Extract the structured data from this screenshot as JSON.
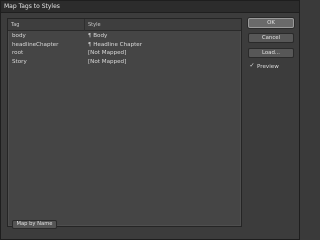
{
  "window": {
    "title": "Map Tags to Styles"
  },
  "table": {
    "headers": {
      "tag": "Tag",
      "style": "Style"
    },
    "rows": [
      {
        "tag": "body",
        "style": "Body",
        "has_icon": true
      },
      {
        "tag": "headlineChapter",
        "style": "Headline Chapter",
        "has_icon": true
      },
      {
        "tag": "root",
        "style": "[Not Mapped]",
        "has_icon": false
      },
      {
        "tag": "Story",
        "style": "[Not Mapped]",
        "has_icon": false
      }
    ],
    "icon_glyph": "¶"
  },
  "buttons": {
    "ok": "OK",
    "cancel": "Cancel",
    "load": "Load...",
    "map_by_name": "Map by Name"
  },
  "preview": {
    "label": "Preview",
    "checked": true,
    "check_glyph": "✓"
  },
  "colors": {
    "background": "#3c3c3c",
    "panel": "#454545",
    "text": "#dcdcdc"
  }
}
